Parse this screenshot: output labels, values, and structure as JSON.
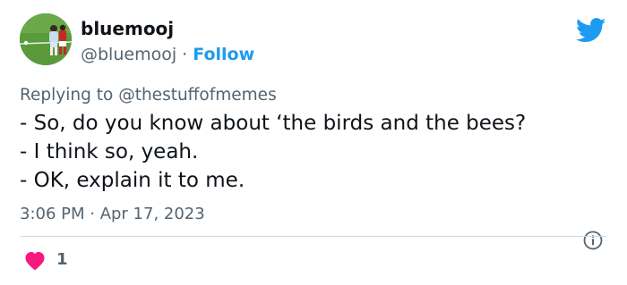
{
  "author": {
    "display_name": "bluemooj",
    "handle": "@bluemooj",
    "separator": "·",
    "follow_label": "Follow"
  },
  "reply": {
    "prefix": "Replying to",
    "mention": "@thestuffofmemes"
  },
  "tweet": {
    "lines": [
      "- So, do you know about ‘the birds and the bees?",
      "- I think so, yeah.",
      "- OK, explain it to me."
    ],
    "timestamp": "3:06 PM · Apr 17, 2023"
  },
  "engagement": {
    "like_count": "1"
  },
  "icons": {
    "brand": "twitter-bird-icon",
    "info": "info-icon",
    "like": "heart-icon"
  },
  "colors": {
    "accent": "#1d9bf0",
    "like": "#f91880",
    "secondary_text": "#536471"
  }
}
